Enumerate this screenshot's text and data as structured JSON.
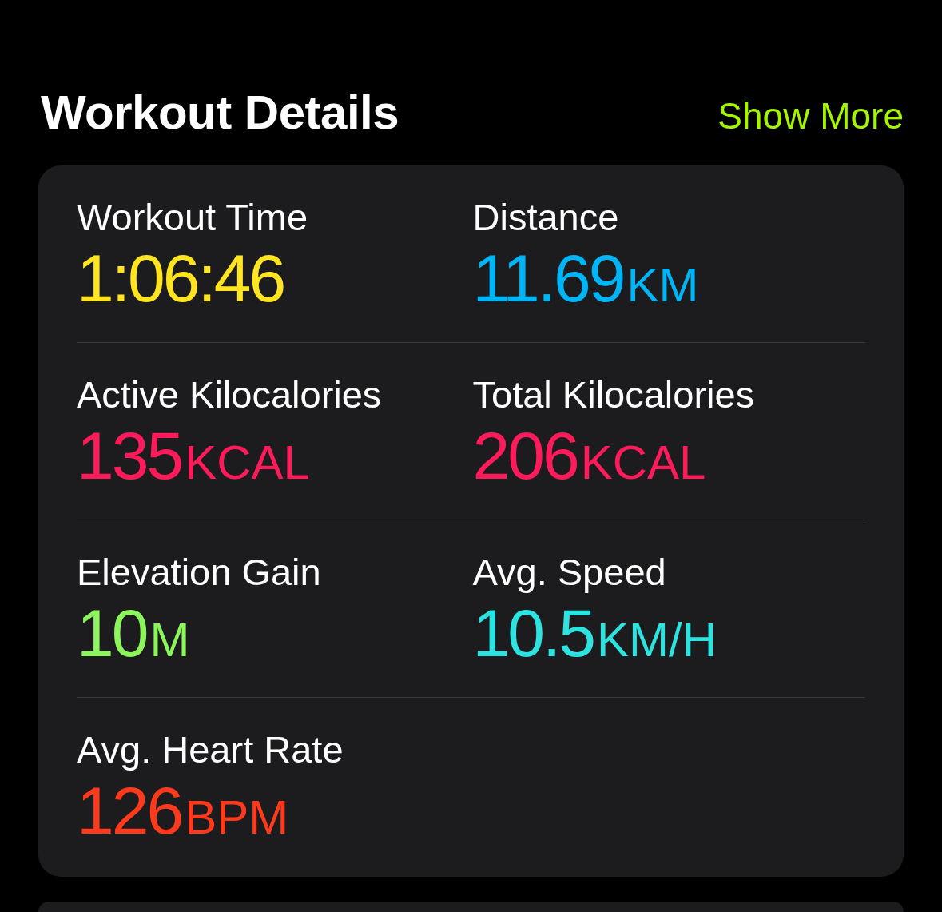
{
  "header": {
    "title": "Workout Details",
    "action": "Show More"
  },
  "metrics": [
    {
      "label": "Workout Time",
      "value": "1:06:46",
      "color": "#ffe41f"
    },
    {
      "label": "Distance",
      "value": "11.69",
      "unit": "KM",
      "color": "#00b5f5"
    },
    {
      "label": "Active Kilocalories",
      "value": "135",
      "unit": "KCAL",
      "color": "#ff1a5a"
    },
    {
      "label": "Total Kilocalories",
      "value": "206",
      "unit": "KCAL",
      "color": "#ff1a5a"
    },
    {
      "label": "Elevation Gain",
      "value": "10",
      "unit": "M",
      "color": "#8cf55c"
    },
    {
      "label": "Avg. Speed",
      "value": "10.5",
      "unit": "KM/H",
      "color": "#2de3e0"
    },
    {
      "label": "Avg. Heart Rate",
      "value": "126",
      "unit": "BPM",
      "color": "#ff3a1c"
    }
  ]
}
